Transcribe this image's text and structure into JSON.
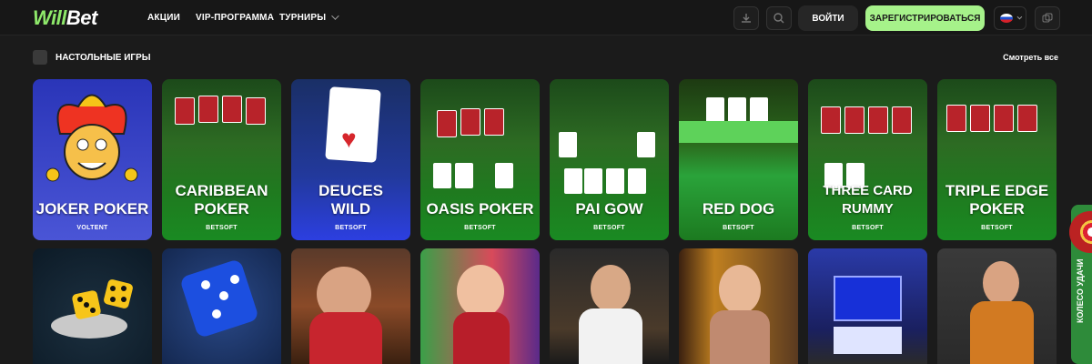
{
  "header": {
    "logo_w": "Will",
    "logo_b": "Bet",
    "nav": [
      "АКЦИИ",
      "VIP-ПРОГРАММА",
      "ТУРНИРЫ"
    ],
    "login_label": "ВОЙТИ",
    "register_label": "ЗАРЕГИСТРИРОВАТЬСЯ"
  },
  "section": {
    "title": "НАСТОЛЬНЫЕ ИГРЫ",
    "see_all": "Смотреть все"
  },
  "games_row1": [
    {
      "title": "JOKER POKER",
      "provider": "VOLTENT"
    },
    {
      "title": "CARIBBEAN POKER",
      "provider": "BETSOFT"
    },
    {
      "title": "DEUCES WILD",
      "provider": "BETSOFT"
    },
    {
      "title": "OASIS POKER",
      "provider": "BETSOFT"
    },
    {
      "title": "PAI GOW",
      "provider": "BETSOFT"
    },
    {
      "title": "RED DOG",
      "provider": "BETSOFT"
    },
    {
      "title": "THREE CARD RUMMY",
      "provider": "BETSOFT"
    },
    {
      "title": "TRIPLE EDGE POKER",
      "provider": "BETSOFT"
    }
  ],
  "side_tab": "КОЛЕСО УДАЧИ",
  "colors": {
    "accent": "#a6f28a",
    "bg": "#1b1b1b",
    "felt": "#1f7a1f"
  }
}
